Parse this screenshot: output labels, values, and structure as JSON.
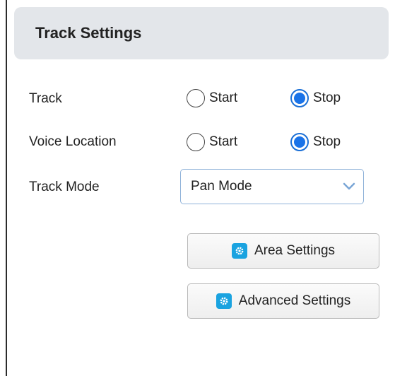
{
  "panel": {
    "title": "Track Settings"
  },
  "rows": {
    "track": {
      "label": "Track",
      "options": [
        "Start",
        "Stop"
      ],
      "selected": "Stop"
    },
    "voice_location": {
      "label": "Voice Location",
      "options": [
        "Start",
        "Stop"
      ],
      "selected": "Stop"
    },
    "track_mode": {
      "label": "Track Mode",
      "value": "Pan Mode"
    }
  },
  "buttons": {
    "area_settings": "Area Settings",
    "advanced_settings": "Advanced Settings"
  },
  "colors": {
    "accent": "#1a73e8",
    "header_bg": "#e3e6ea",
    "button_icon": "#1aa3e0"
  },
  "icons": {
    "chevron": "chevron-down-icon",
    "settings": "gear-icon"
  }
}
